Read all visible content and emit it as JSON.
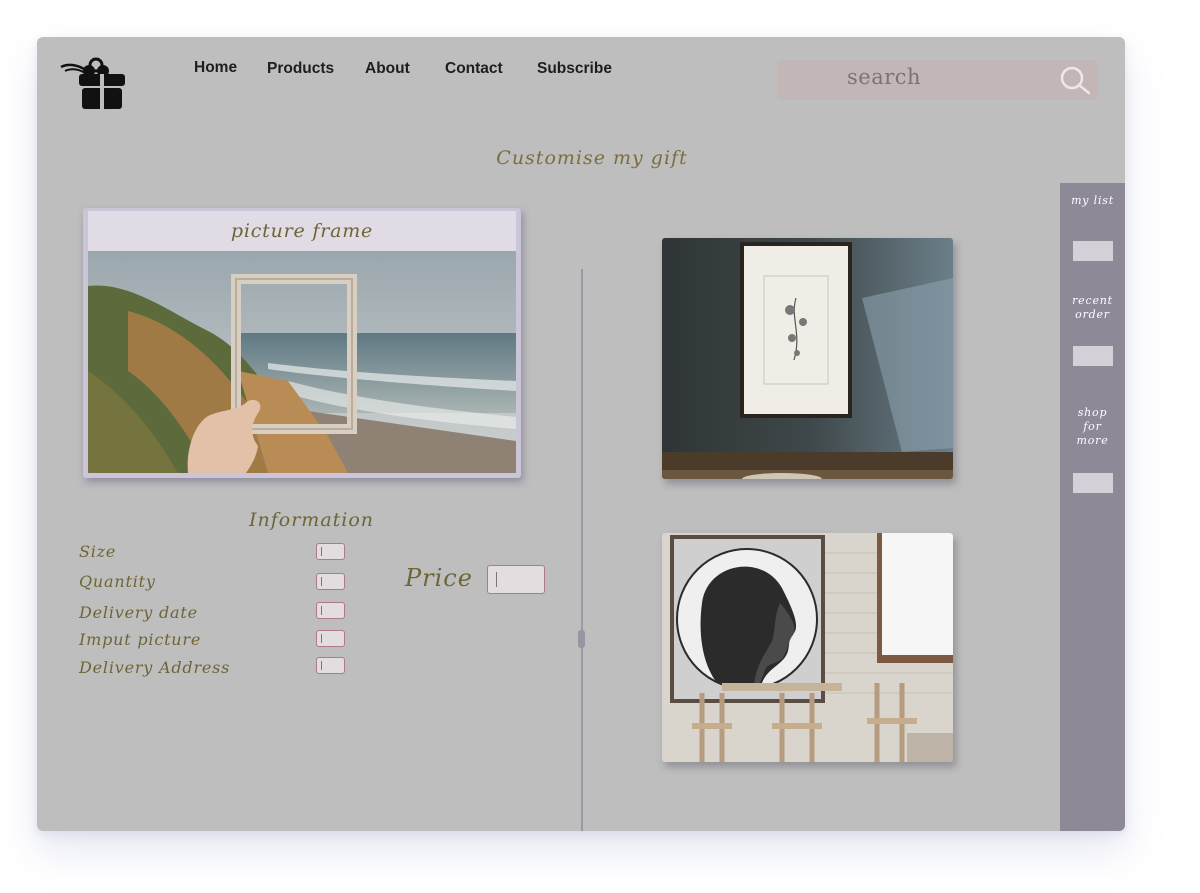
{
  "nav": {
    "items": [
      "Home",
      "Products",
      "About",
      "Contact",
      "Subscribe"
    ]
  },
  "search": {
    "placeholder": "search"
  },
  "page": {
    "title": "Customise my gift"
  },
  "product": {
    "title": "picture frame"
  },
  "information": {
    "heading": "Information",
    "fields": [
      "Size",
      "Quantity",
      "Delivery date",
      "Imput picture",
      "Delivery Address"
    ]
  },
  "price": {
    "label": "Price"
  },
  "sidebar": {
    "items": [
      {
        "label": "my list"
      },
      {
        "label": "recent order"
      },
      {
        "label": "shop for more"
      }
    ]
  },
  "colors": {
    "background": "#bebebe",
    "accent_text": "#6e6536",
    "sidebar": "#8d8997",
    "search_bg": "#c2b6b6"
  }
}
